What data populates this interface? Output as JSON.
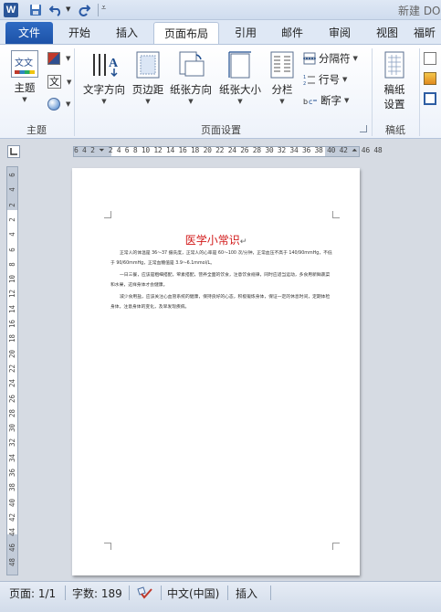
{
  "titlebar": {
    "app_icon": "W",
    "doc_title": "新建 DO"
  },
  "tabs": [
    {
      "label": "文件"
    },
    {
      "label": "开始"
    },
    {
      "label": "插入"
    },
    {
      "label": "页面布局"
    },
    {
      "label": "引用"
    },
    {
      "label": "邮件"
    },
    {
      "label": "审阅"
    },
    {
      "label": "视图"
    },
    {
      "label": "福昕"
    }
  ],
  "ribbon": {
    "theme": {
      "label": "主题",
      "thumb_text": "文文",
      "group_label": "主题"
    },
    "page_setup": {
      "group_label": "页面设置",
      "text_direction": "文字方向",
      "margins": "页边距",
      "orientation": "纸张方向",
      "size": "纸张大小",
      "columns": "分栏",
      "breaks": "分隔符",
      "line_numbers": "行号",
      "hyphenation": "断字"
    },
    "draft": {
      "label_line1": "稿纸",
      "label_line2": "设置",
      "group_label": "稿纸"
    }
  },
  "ruler": {
    "h_numbers": "6  4  2  ⏷  2  4  6  8 10 12 14 16 18 20 22 24 26 28 30 32 34 36 38 40 42  ⏶ 46 48",
    "v_numbers": [
      "6",
      "4",
      "2",
      "2",
      "4",
      "6",
      "8",
      "10",
      "12",
      "14",
      "16",
      "18",
      "20",
      "22",
      "24",
      "26",
      "28",
      "30",
      "32",
      "34",
      "36",
      "38",
      "40",
      "42",
      "44",
      "46",
      "48"
    ]
  },
  "document": {
    "heading": "医学小常识",
    "paragraph_mark": "↵",
    "paragraphs": [
      "正常人的体温是 36～37 摄氏度，正常人的心率是 60～100 次/分钟，正常血压不高于 140/90mmHg，不低于 90/60mmHg，正常血糖值是 3.9～6.1mmol/L。",
      "一日三餐，应该是粗细搭配，荤素搭配，营养全面的饮食，注意饮食规律，同时应适当运动，多食用新鲜蔬菜和水果，这样身体才会健康。",
      "减少食用盐，应该关注心血管系统的健康，保持良好的心态，积极锻炼身体，保证一定的休息时间，定期体检身体，注意身体的变化，及早发现疾病。"
    ]
  },
  "statusbar": {
    "page": "页面: 1/1",
    "words": "字数: 189",
    "language": "中文(中国)",
    "mode": "插入"
  },
  "colors": {
    "file_tab": "#1d52a8",
    "heading": "#d21a1a",
    "ribbon_bg": "#edf2fa"
  }
}
